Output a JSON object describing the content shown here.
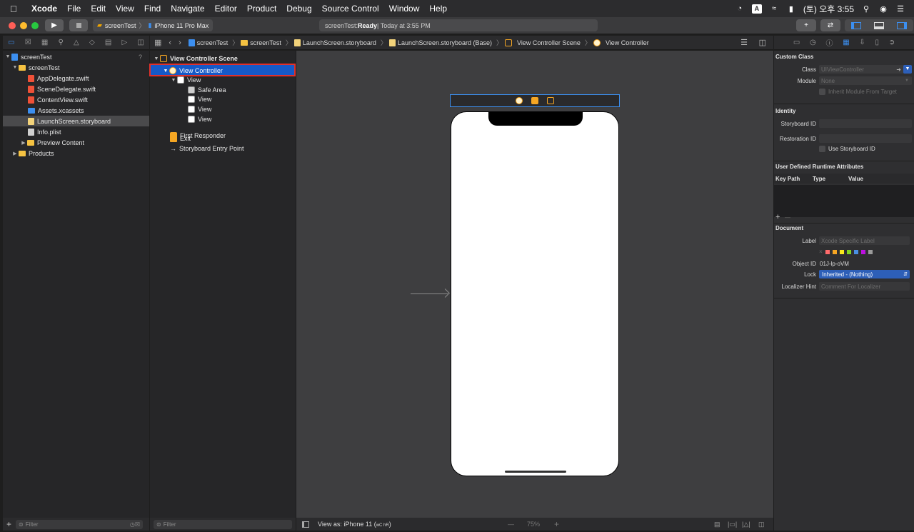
{
  "menubar": {
    "items": [
      "Xcode",
      "File",
      "Edit",
      "View",
      "Find",
      "Navigate",
      "Editor",
      "Product",
      "Debug",
      "Source Control",
      "Window",
      "Help"
    ],
    "clock": "(토) 오후 3:55",
    "input_badge": "A"
  },
  "toolbar": {
    "scheme": "screenTest",
    "device": "iPhone 11 Pro Max",
    "activity_project": "screenTest: ",
    "activity_status": "Ready",
    "activity_time": " | Today at 3:55 PM",
    "add_label": "+",
    "swap_label": "⇄"
  },
  "navigator": {
    "items": [
      {
        "label": "screenTest",
        "extra": "?"
      },
      {
        "label": "screenTest"
      },
      {
        "label": "AppDelegate.swift"
      },
      {
        "label": "SceneDelegate.swift"
      },
      {
        "label": "ContentView.swift"
      },
      {
        "label": "Assets.xcassets"
      },
      {
        "label": "LaunchScreen.storyboard"
      },
      {
        "label": "Info.plist"
      },
      {
        "label": "Preview Content"
      },
      {
        "label": "Products"
      }
    ],
    "filter_placeholder": "Filter"
  },
  "jumpbar": {
    "crumbs": [
      "screenTest",
      "screenTest",
      "LaunchScreen.storyboard",
      "LaunchScreen.storyboard (Base)",
      "View Controller Scene",
      "View Controller"
    ]
  },
  "outline": {
    "items": [
      {
        "label": "View Controller Scene"
      },
      {
        "label": "View Controller"
      },
      {
        "label": "View"
      },
      {
        "label": "Safe Area"
      },
      {
        "label": "View"
      },
      {
        "label": "View"
      },
      {
        "label": "View"
      },
      {
        "label": "First Responder"
      },
      {
        "label": "Exit"
      },
      {
        "label": "Storyboard Entry Point"
      }
    ],
    "filter_placeholder": "Filter"
  },
  "canvas": {
    "view_as": "View as: iPhone 11 (",
    "view_as_traits": "wC hR",
    "view_as_end": ")",
    "zoom": "75%",
    "zoom_minus": "—",
    "zoom_plus": "+"
  },
  "inspector": {
    "custom_class": {
      "heading": "Custom Class",
      "class_label": "Class",
      "class_placeholder": "UIViewController",
      "module_label": "Module",
      "module_value": "None",
      "inherit_label": "Inherit Module From Target"
    },
    "identity": {
      "heading": "Identity",
      "storyboard_id_label": "Storyboard ID",
      "restoration_id_label": "Restoration ID",
      "use_storyboard_label": "Use Storyboard ID"
    },
    "udra": {
      "heading": "User Defined Runtime Attributes",
      "col_keypath": "Key Path",
      "col_type": "Type",
      "col_value": "Value",
      "add": "+",
      "remove": "—"
    },
    "document": {
      "heading": "Document",
      "label_label": "Label",
      "label_placeholder": "Xcode Specific Label",
      "object_id_label": "Object ID",
      "object_id_value": "01J-lp-oVM",
      "lock_label": "Lock",
      "lock_value": "Inherited - (Nothing)",
      "localizer_label": "Localizer Hint",
      "localizer_placeholder": "Comment For Localizer",
      "swatch_colors": [
        "#ff6b6b",
        "#f5a623",
        "#f8e71c",
        "#7ed321",
        "#4a90e2",
        "#bd10e0",
        "#9b9b9b"
      ]
    }
  },
  "colors": {
    "accent": "#3c8ff0",
    "selection": "#1659c7",
    "highlight_border": "#e0302a"
  }
}
